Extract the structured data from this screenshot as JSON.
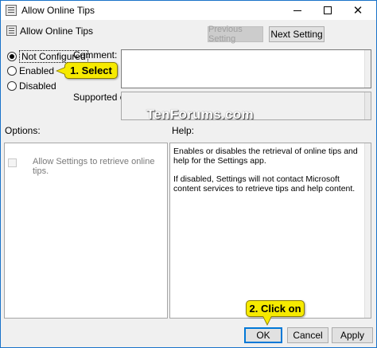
{
  "window": {
    "title": "Allow Online Tips",
    "icon": "policy-icon",
    "controls": {
      "minimize": "",
      "maximize": "",
      "close": "✕"
    }
  },
  "header": {
    "policy_title": "Allow Online Tips",
    "icon": "policy-icon",
    "previous_setting_label": "Previous Setting",
    "next_setting_label": "Next Setting"
  },
  "state": {
    "options": [
      {
        "label": "Not Configured",
        "checked": true
      },
      {
        "label": "Enabled",
        "checked": false
      },
      {
        "label": "Disabled",
        "checked": false
      }
    ]
  },
  "comment": {
    "label": "Comment:",
    "value": ""
  },
  "supported_on": {
    "label": "Supported on:",
    "value": ""
  },
  "watermark": "TenForums.com",
  "options_panel": {
    "label": "Options:",
    "checkbox_label": "Allow Settings to retrieve online tips.",
    "checkbox_checked": false
  },
  "help_panel": {
    "label": "Help:",
    "paragraphs": [
      "Enables or disables the retrieval of online tips and help for the Settings app.",
      "If disabled, Settings will not contact Microsoft content services to retrieve tips and help content."
    ]
  },
  "footer": {
    "ok_label": "OK",
    "cancel_label": "Cancel",
    "apply_label": "Apply"
  },
  "annotations": {
    "callout_1": "1. Select",
    "callout_2": "2. Click on"
  },
  "colors": {
    "window_border": "#1a73c9",
    "dialog_bg": "#f0f0f0",
    "callout_fill": "#f6ea00",
    "ok_focus": "#0078d7"
  }
}
